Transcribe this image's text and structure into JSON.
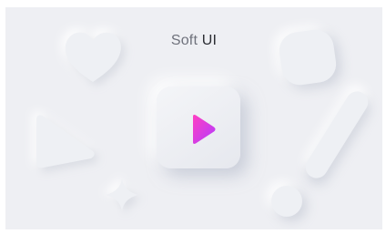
{
  "title": {
    "part1": "Soft",
    "part2": "UI"
  },
  "icons": {
    "play": "play-icon"
  },
  "colors": {
    "background": "#eeeff3",
    "play_gradient_start": "#ff3fc2",
    "play_gradient_end": "#b33cff"
  }
}
